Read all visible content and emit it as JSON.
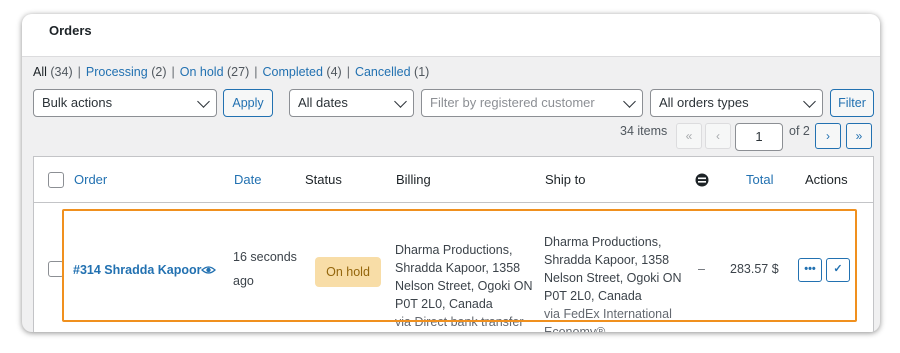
{
  "page": {
    "title": "Orders"
  },
  "filters": [
    {
      "label": "All",
      "count": "(34)",
      "current": true
    },
    {
      "label": "Processing",
      "count": "(2)"
    },
    {
      "label": "On hold",
      "count": "(27)"
    },
    {
      "label": "Completed",
      "count": "(4)"
    },
    {
      "label": "Cancelled",
      "count": "(1)"
    }
  ],
  "toolbar": {
    "bulk_actions": "Bulk actions",
    "apply": "Apply",
    "dates": "All dates",
    "customer_placeholder": "Filter by registered customer",
    "order_types": "All orders types",
    "filter": "Filter"
  },
  "pagination": {
    "items": "34 items",
    "first": "«",
    "prev": "‹",
    "current_page": "1",
    "of_total": "of 2",
    "next": "›",
    "last": "»"
  },
  "table": {
    "headers": {
      "order": "Order",
      "date": "Date",
      "status": "Status",
      "billing": "Billing",
      "ship_to": "Ship to",
      "total": "Total",
      "actions": "Actions"
    },
    "row": {
      "order": "#314 Shradda Kapoor",
      "date_line1": "16 seconds",
      "date_line2": "ago",
      "status": "On hold",
      "billing_line1": "Dharma Productions,",
      "billing_line2": "Shradda Kapoor, 1358",
      "billing_line3": "Nelson Street, Ogoki ON",
      "billing_line4": "P0T 2L0, Canada",
      "billing_via": "via Direct bank transfer",
      "ship_line1": "Dharma Productions,",
      "ship_line2": "Shradda Kapoor, 1358",
      "ship_line3": "Nelson Street, Ogoki ON",
      "ship_line4": "P0T 2L0, Canada",
      "ship_via1": "via FedEx International",
      "ship_via2": "Economy®",
      "dash": "–",
      "total": "283.57 $",
      "action_more": "•••",
      "action_complete": "✓"
    }
  },
  "colors": {
    "accent": "#2271b1",
    "highlight": "#f0901e",
    "badge_bg": "#f8dda7"
  }
}
